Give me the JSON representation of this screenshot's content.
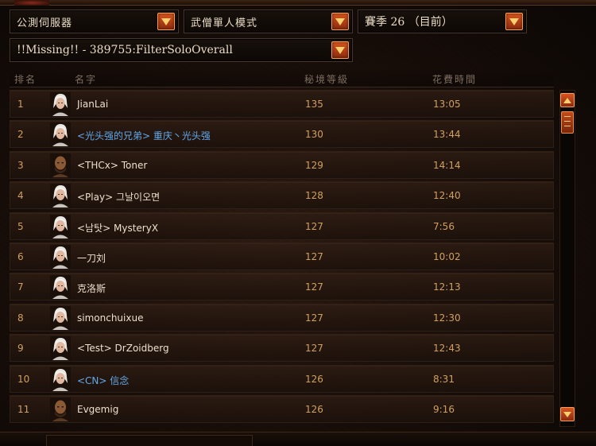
{
  "filters": {
    "server": "公測伺服器",
    "mode": "武僧單人模式",
    "season": "賽季 26 （目前）",
    "leaderboard": "!!Missing!! - 389755:FilterSoloOverall"
  },
  "columns": {
    "rank": "排名",
    "name": "名字",
    "level": "秘境等級",
    "time": "花費時間"
  },
  "avatar_types": {
    "pale": "white-hair-monk-portrait",
    "dark": "bald-bearded-monk-portrait"
  },
  "rows": [
    {
      "rank": "1",
      "name": "JianLai",
      "clan": false,
      "level": "135",
      "time": "13:05",
      "avatar": "pale"
    },
    {
      "rank": "2",
      "name": "<光头强的兄弟> 重庆丶光头强",
      "clan": true,
      "level": "130",
      "time": "13:44",
      "avatar": "pale"
    },
    {
      "rank": "3",
      "name": "<THCx> Toner",
      "clan": false,
      "level": "129",
      "time": "14:14",
      "avatar": "dark"
    },
    {
      "rank": "4",
      "name": "<Play> 그날이오면",
      "clan": false,
      "level": "128",
      "time": "12:40",
      "avatar": "pale"
    },
    {
      "rank": "5",
      "name": "<남탓> MysteryX",
      "clan": false,
      "level": "127",
      "time": "7:56",
      "avatar": "pale"
    },
    {
      "rank": "6",
      "name": "一刀刘",
      "clan": false,
      "level": "127",
      "time": "10:02",
      "avatar": "pale"
    },
    {
      "rank": "7",
      "name": "克洛斯",
      "clan": false,
      "level": "127",
      "time": "12:13",
      "avatar": "pale"
    },
    {
      "rank": "8",
      "name": "simonchuixue",
      "clan": false,
      "level": "127",
      "time": "12:30",
      "avatar": "pale"
    },
    {
      "rank": "9",
      "name": "<Test> DrZoidberg",
      "clan": false,
      "level": "127",
      "time": "12:43",
      "avatar": "pale"
    },
    {
      "rank": "10",
      "name": "<CN> 信念",
      "clan": true,
      "level": "126",
      "time": "8:31",
      "avatar": "pale"
    },
    {
      "rank": "11",
      "name": "Evgemig",
      "clan": false,
      "level": "126",
      "time": "9:16",
      "avatar": "dark"
    }
  ],
  "colors": {
    "accent_orange": "#d9541f",
    "gold_text": "#d0a060",
    "clan_blue": "#63a8e8",
    "name_white": "#ece0cc"
  },
  "icons": {
    "dropdown": "chevron-down-icon",
    "scroll_up": "arrow-up-icon",
    "scroll_down": "arrow-down-icon"
  }
}
